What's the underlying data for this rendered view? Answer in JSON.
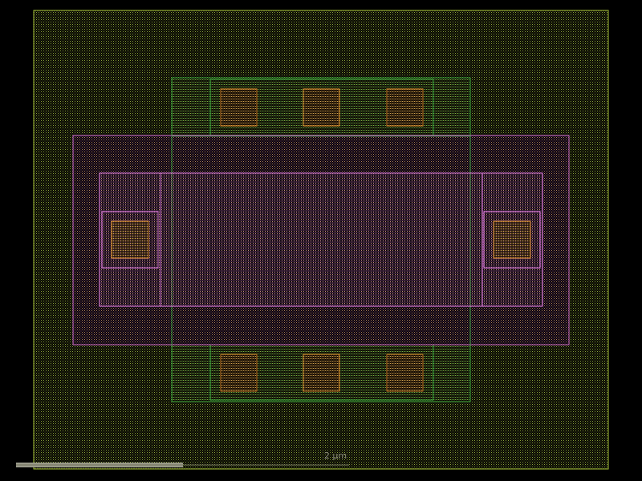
{
  "scale_bar": {
    "label": "2 µm",
    "bar_color": "#9a9a8a",
    "line_color": "#6e6e5a"
  },
  "layers": {
    "well": {
      "color": "#a8c43a"
    },
    "diffusion": {
      "color": "#2f9a36"
    },
    "poly_implant": {
      "color": "#c25fc2"
    },
    "gate": {
      "color": "#e07ae0"
    },
    "contact": {
      "color": "#d98a2a"
    }
  }
}
